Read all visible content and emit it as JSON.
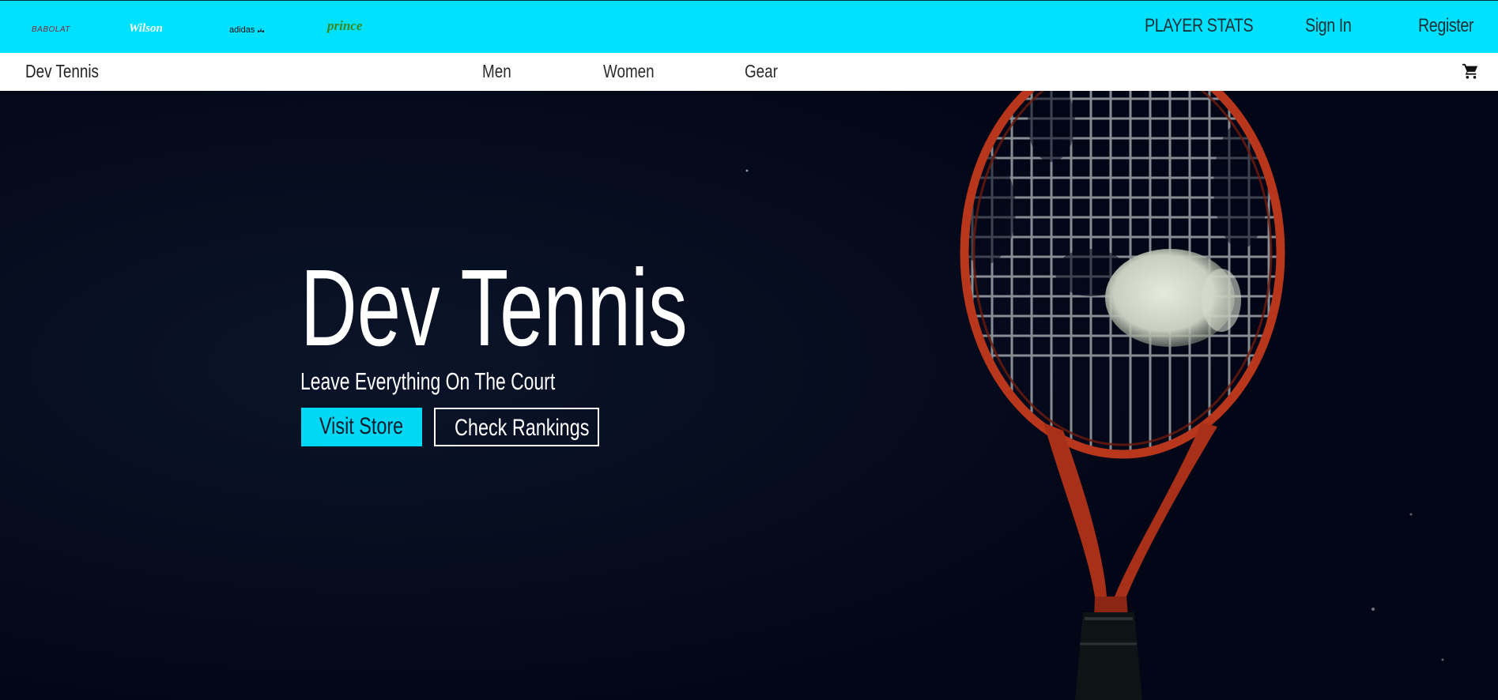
{
  "brands": [
    {
      "name": "BABOLAT",
      "color": "#7a2a3a"
    },
    {
      "name": "Wilson",
      "color": "#ffffff"
    },
    {
      "name": "adidas",
      "color": "#111111"
    },
    {
      "name": "prince",
      "color": "#3a8a20"
    }
  ],
  "top_links": {
    "stats": "PLAYER STATS",
    "sign_in": "Sign In",
    "register": "Register"
  },
  "nav": {
    "brand": "Dev Tennis",
    "items": [
      "Men",
      "Women",
      "Gear"
    ],
    "cart_icon": "cart-icon"
  },
  "hero": {
    "title": "Dev Tennis",
    "subtitle": "Leave Everything On The Court",
    "primary_button": "Visit Store",
    "secondary_button": "Check Rankings"
  },
  "colors": {
    "accent": "#00e1ff",
    "hero_bg": "#03081a",
    "racket": "#b8361c"
  }
}
